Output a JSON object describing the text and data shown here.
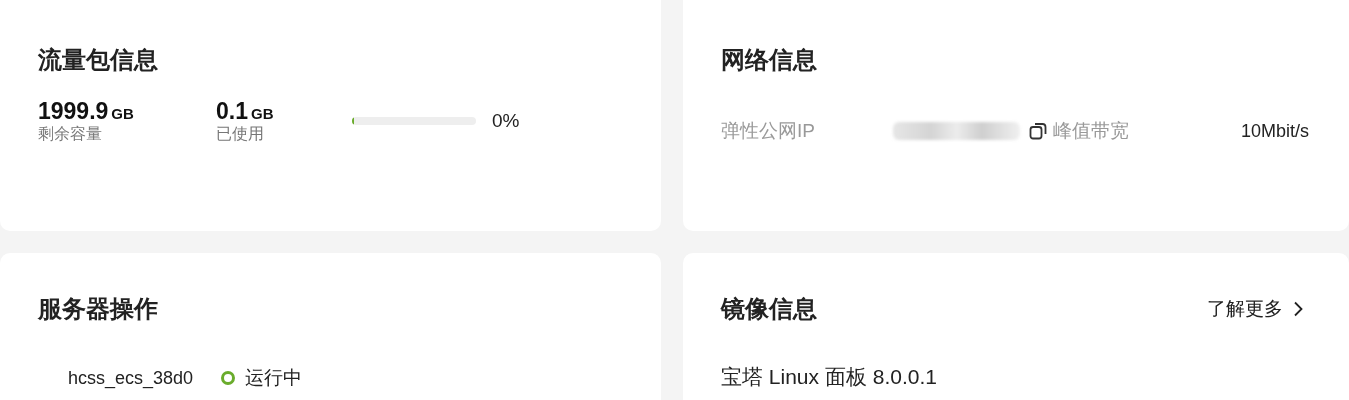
{
  "traffic_card": {
    "title": "流量包信息",
    "stats": [
      {
        "value": "1999.9",
        "unit": "GB",
        "label": "剩余容量"
      },
      {
        "value": "0.1",
        "unit": "GB",
        "label": "已使用"
      }
    ],
    "usage": {
      "level": 0,
      "reading": "0%"
    }
  },
  "network_card": {
    "title": "网络信息",
    "ip_label": "弹性公网IP",
    "bandwidth_label": "峰值带宽",
    "bandwidth_value": "10Mbit/s"
  },
  "server_card": {
    "title": "服务器操作",
    "server_name": "hcss_ecs_38d0",
    "status": {
      "text": "运行中",
      "color": "#6aac2c"
    }
  },
  "image_card": {
    "title": "镜像信息",
    "more_link": "了解更多",
    "image_name": "宝塔 Linux 面板 8.0.0.1"
  }
}
